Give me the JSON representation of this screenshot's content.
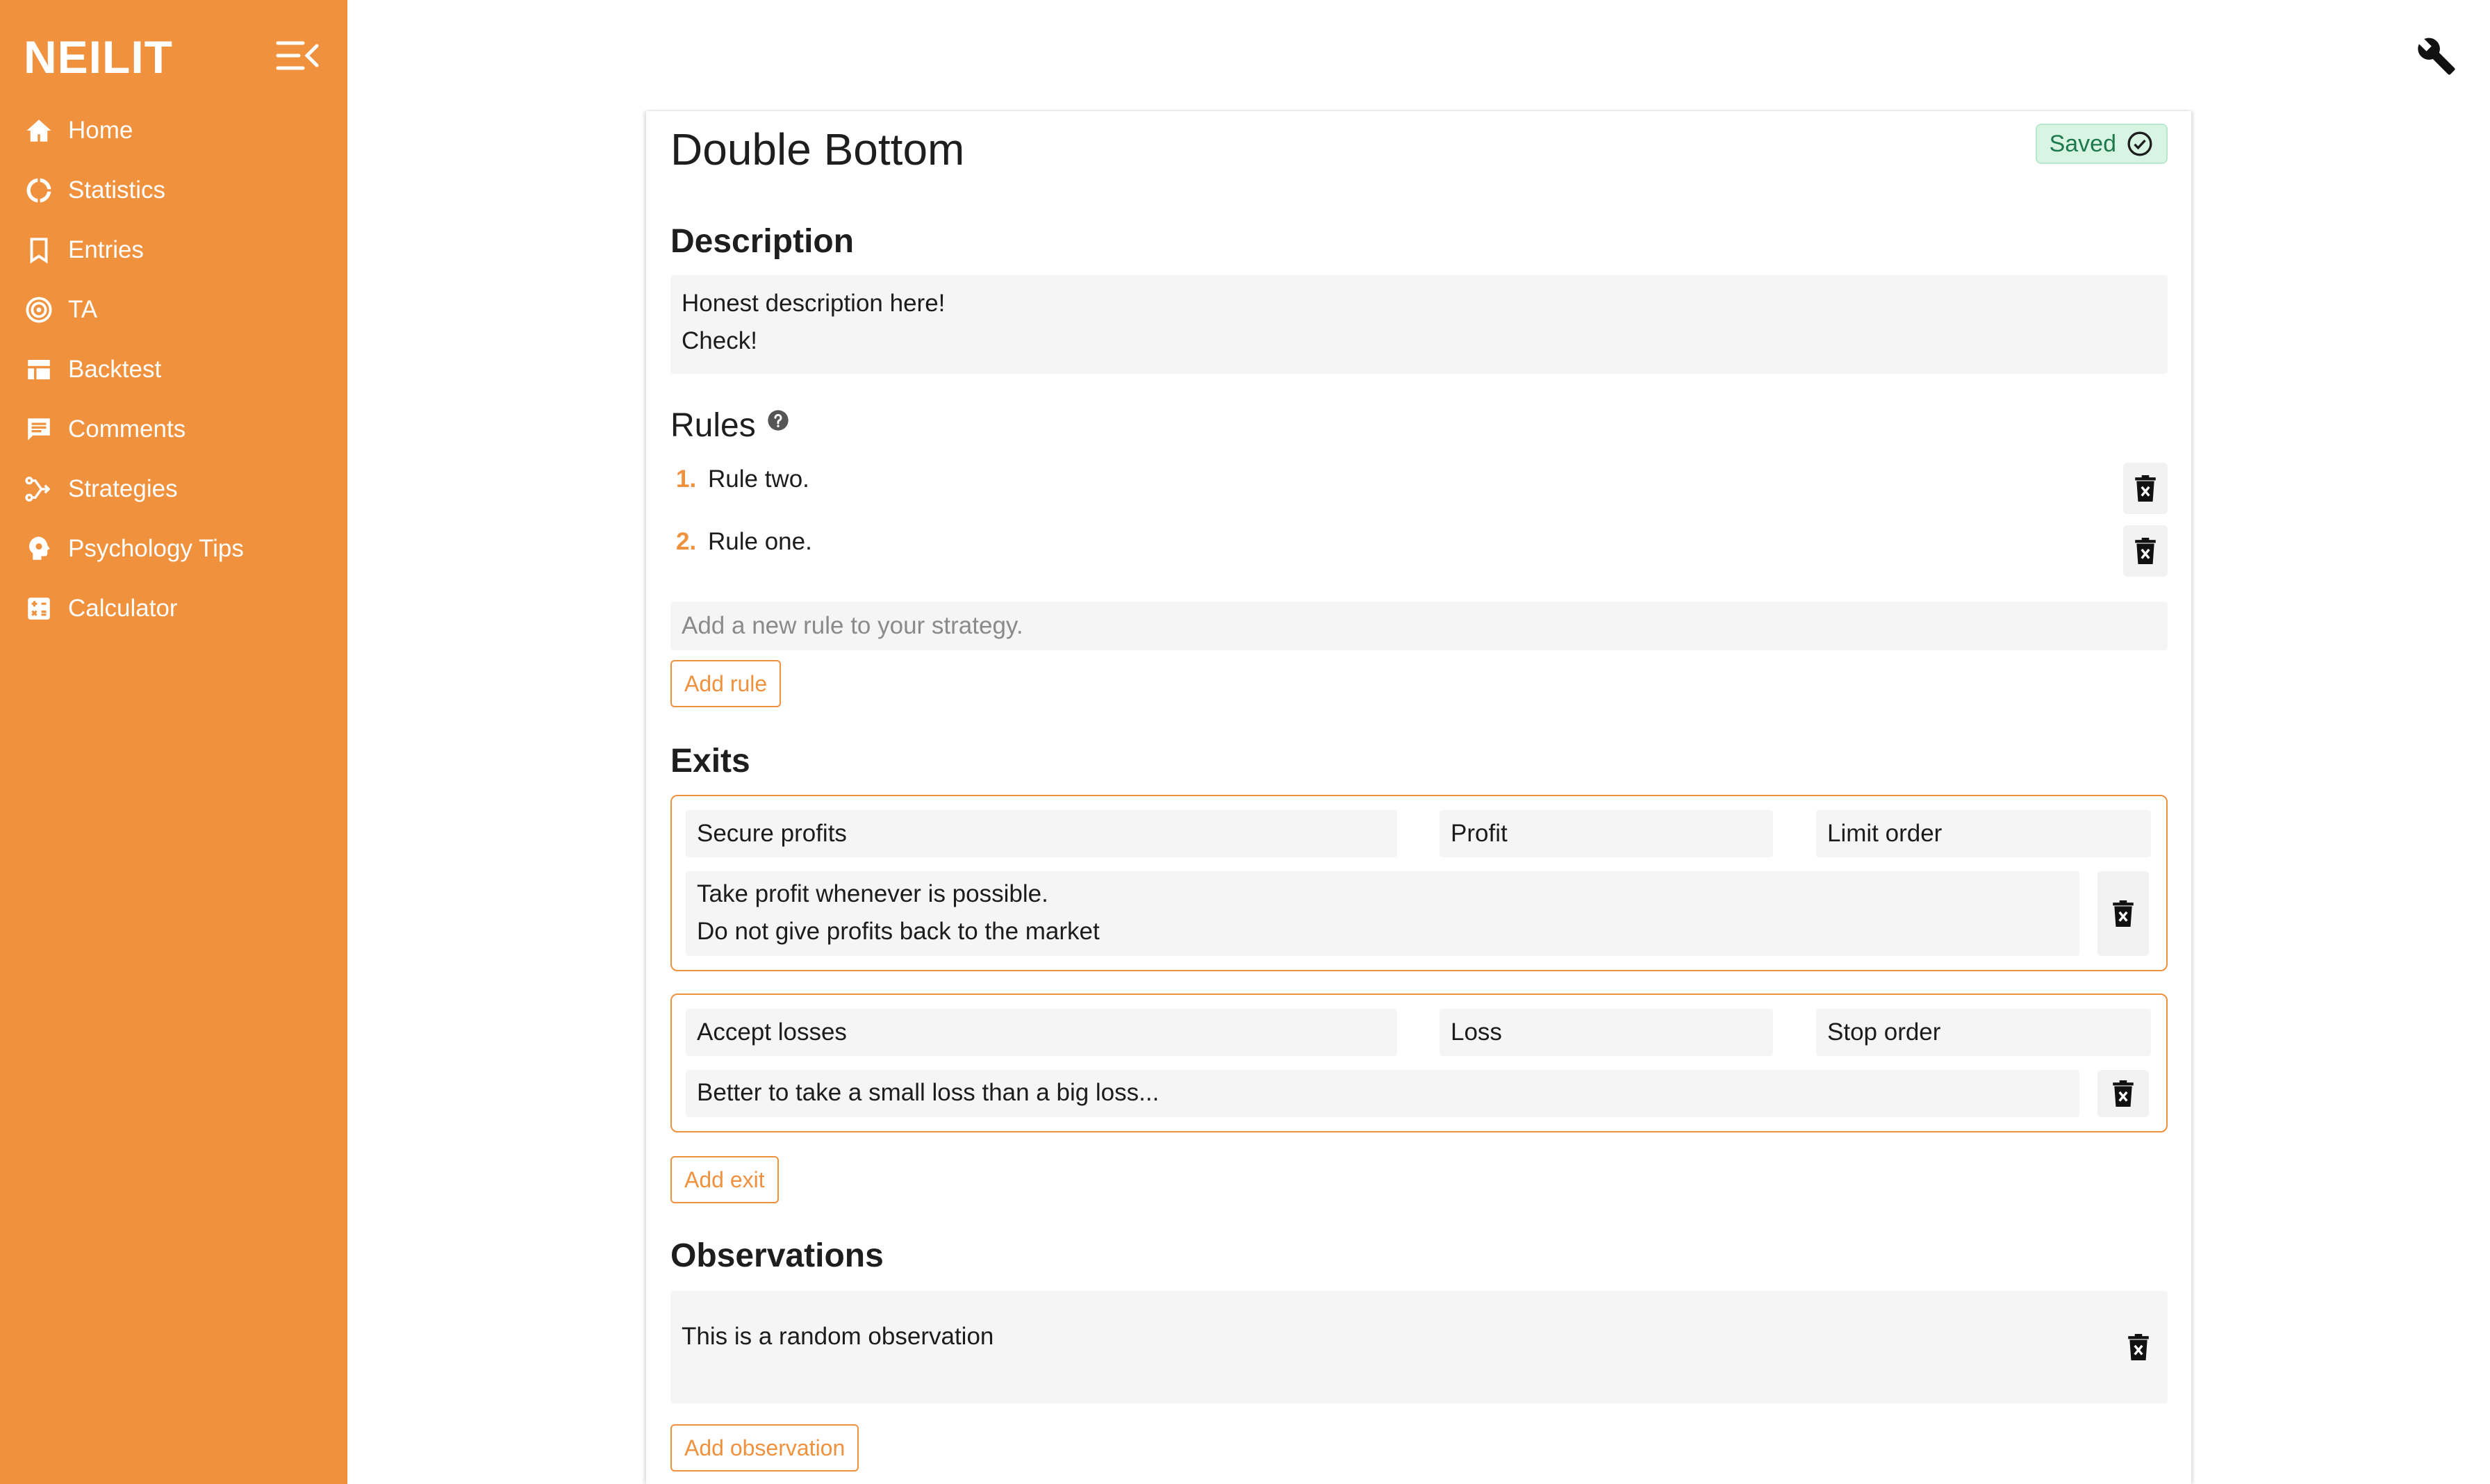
{
  "app": {
    "logo": "NEILIT",
    "accent_color": "#f0913e"
  },
  "sidebar": {
    "items": [
      {
        "label": "Home",
        "icon": "home-icon"
      },
      {
        "label": "Statistics",
        "icon": "statistics-icon"
      },
      {
        "label": "Entries",
        "icon": "bookmark-icon"
      },
      {
        "label": "TA",
        "icon": "target-icon"
      },
      {
        "label": "Backtest",
        "icon": "table-icon"
      },
      {
        "label": "Comments",
        "icon": "comment-icon"
      },
      {
        "label": "Strategies",
        "icon": "strategy-icon"
      },
      {
        "label": "Psychology Tips",
        "icon": "brain-icon"
      },
      {
        "label": "Calculator",
        "icon": "calculator-icon"
      }
    ]
  },
  "header": {
    "tool_icon": "wrench-icon"
  },
  "strategy": {
    "title": "Double Bottom",
    "status": "Saved",
    "description_heading": "Description",
    "description": "Honest description here!\nCheck!",
    "rules_heading": "Rules",
    "rules": [
      {
        "number": "1.",
        "text": "Rule two."
      },
      {
        "number": "2.",
        "text": "Rule one."
      }
    ],
    "new_rule_placeholder": "Add a new rule to your strategy.",
    "add_rule_label": "Add rule",
    "exits_heading": "Exits",
    "exits": [
      {
        "name": "Secure profits",
        "type": "Profit",
        "order": "Limit order",
        "description": "Take profit whenever is possible.\nDo not give profits back to the market"
      },
      {
        "name": "Accept losses",
        "type": "Loss",
        "order": "Stop order",
        "description": "Better to take a small loss than a big loss..."
      }
    ],
    "add_exit_label": "Add exit",
    "observations_heading": "Observations",
    "observations": [
      {
        "text": "This is a random observation"
      }
    ],
    "add_observation_label": "Add observation"
  }
}
